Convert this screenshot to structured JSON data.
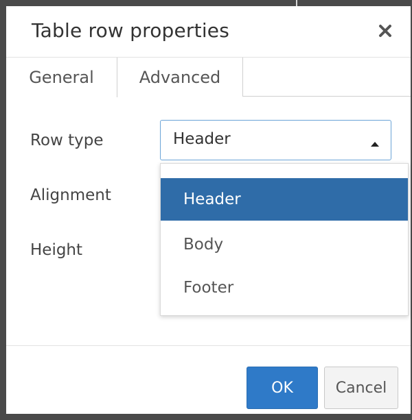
{
  "dialog": {
    "title": "Table row properties",
    "close_icon": "close-icon"
  },
  "tabs": [
    {
      "label": "General",
      "active": true
    },
    {
      "label": "Advanced",
      "active": false
    }
  ],
  "form": {
    "row_type_label": "Row type",
    "alignment_label": "Alignment",
    "height_label": "Height",
    "row_type_value": "Header"
  },
  "dropdown": {
    "options": [
      "Header",
      "Body",
      "Footer"
    ],
    "selected": "Header"
  },
  "footer": {
    "ok_label": "OK",
    "cancel_label": "Cancel"
  },
  "colors": {
    "accent": "#2f7ac8",
    "selected_option": "#2f6ca8"
  }
}
